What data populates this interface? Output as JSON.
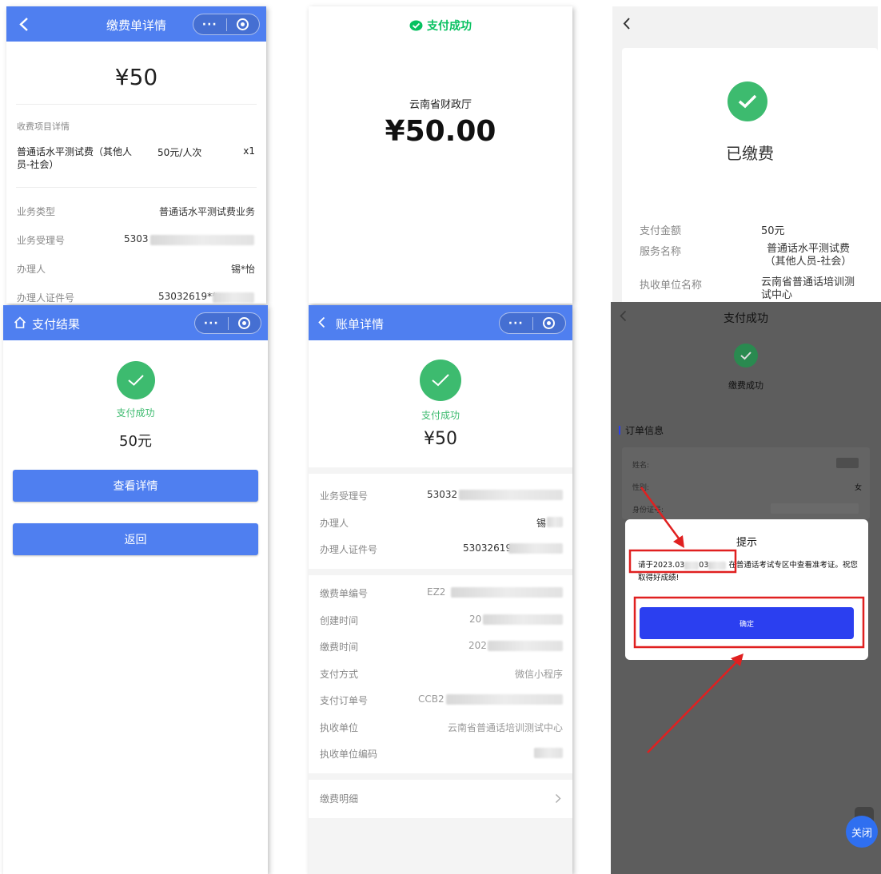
{
  "colors": {
    "primary_blue": "#4f7ff0",
    "success_green": "#3dbb6f",
    "wechat_green": "#07c160",
    "confirm_blue": "#2b3ff0",
    "annotation_red": "#e02020"
  },
  "icons": {
    "back": "chevron-left-icon",
    "home": "home-icon",
    "more": "more-dots-icon",
    "target": "target-icon",
    "check": "checkmark-icon",
    "wechat": "wechat-pay-icon",
    "arrow_right": "chevron-right-icon"
  },
  "p1": {
    "title": "缴费单详情",
    "more": "···",
    "amount": "¥50",
    "section": "收费项目详情",
    "item_name": "普通话水平测试费（其他人员-社会）",
    "item_price": "50元/人次",
    "item_qty": "x1",
    "rows": [
      {
        "label": "业务类型",
        "value": "普通话水平测试费业务"
      },
      {
        "label": "业务受理号",
        "value": "5303"
      },
      {
        "label": "办理人",
        "value": "锡*怡"
      },
      {
        "label": "办理人证件号",
        "value": "53032619**"
      }
    ]
  },
  "p2": {
    "status": "支付成功",
    "payee": "云南省财政厅",
    "amount": "¥50.00"
  },
  "p3": {
    "status": "已缴费",
    "rows": [
      {
        "label": "支付金额",
        "value": "50元"
      },
      {
        "label": "服务名称",
        "value": "普通话水平测试费（其他人员-社会）"
      },
      {
        "label": "执收单位名称",
        "value": "云南省普通话培训测试中心"
      }
    ]
  },
  "p4": {
    "title": "支付结果",
    "more": "···",
    "status": "支付成功",
    "amount": "50元",
    "btn_detail": "查看详情",
    "btn_back": "返回"
  },
  "p5": {
    "title": "账单详情",
    "more": "···",
    "status": "支付成功",
    "amount": "¥50",
    "group1": [
      {
        "label": "业务受理号",
        "value": "53032"
      },
      {
        "label": "办理人",
        "value": "锡"
      },
      {
        "label": "办理人证件号",
        "value": "53032619"
      }
    ],
    "group2": [
      {
        "label": "缴费单编号",
        "value": "EZ2"
      },
      {
        "label": "创建时间",
        "value": "20"
      },
      {
        "label": "缴费时间",
        "value": "202"
      },
      {
        "label": "支付方式",
        "value": "微信小程序"
      },
      {
        "label": "支付订单号",
        "value": "CCB2"
      },
      {
        "label": "执收单位",
        "value": "云南省普通话培训测试中心"
      },
      {
        "label": "执收单位编码",
        "value": ""
      }
    ],
    "detail_link": "缴费明细"
  },
  "p6": {
    "title": "支付成功",
    "status": "缴费成功",
    "section": "订单信息",
    "name_label": "姓名:",
    "gender_label": "性别:",
    "gender_value": "女",
    "id_label": "身份证号:",
    "dialog_title": "提示",
    "dialog_text_a": "请于2023.03",
    "dialog_text_b": "03",
    "dialog_text_c": "在普通话考试专区中查看准考证。祝您取得好成绩!",
    "confirm": "确定",
    "close": "关闭"
  }
}
